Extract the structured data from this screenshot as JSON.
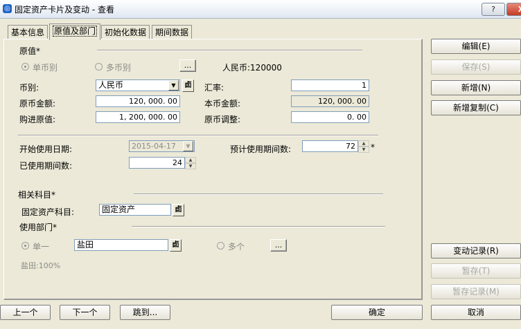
{
  "window": {
    "title": "固定资产卡片及变动 - 查看",
    "help_label": "?",
    "close_label": "X"
  },
  "tabs": [
    "基本信息",
    "原值及部门",
    "初始化数据",
    "期间数据"
  ],
  "original_value": {
    "section_title": "原值*",
    "radio_single": "单币别",
    "radio_multi": "多币别",
    "browse_label": "...",
    "currency_info": "人民币:120000",
    "currency_label": "币别:",
    "currency_value": "人民币",
    "rate_label": "汇率:",
    "rate_value": "1",
    "orig_amount_label": "原币金额:",
    "orig_amount_value": "120, 000. 00",
    "local_amount_label": "本币金额:",
    "local_amount_value": "120, 000. 00",
    "purchase_value_label": "购进原值:",
    "purchase_value_value": "1, 200, 000. 00",
    "orig_adjust_label": "原币调整:",
    "orig_adjust_value": "0. 00"
  },
  "usage": {
    "start_date_label": "开始使用日期:",
    "start_date_value": "2015-04-17",
    "expected_periods_label": "预计使用期间数:",
    "expected_periods_value": "72",
    "required_mark": "*",
    "used_periods_label": "已使用期间数:",
    "used_periods_value": "24"
  },
  "accounts": {
    "section_title": "相关科目*",
    "asset_account_label": "固定资产科目:",
    "asset_account_value": "固定资产"
  },
  "department": {
    "section_title": "使用部门*",
    "radio_single": "单一",
    "dept_value": "盐田",
    "radio_multi": "多个",
    "browse_label": "...",
    "allocation_text": "盐田:100%"
  },
  "ref_icon_label": "卣",
  "right_buttons": {
    "edit": "编辑(E)",
    "save": "保存(S)",
    "new": "新增(N)",
    "new_copy": "新增复制(C)",
    "change_record": "变动记录(R)",
    "temp_save": "暂存(T)",
    "temp_record": "暂存记录(M)"
  },
  "bottom_buttons": {
    "prev": "上一个",
    "next": "下一个",
    "jump": "跳到...",
    "ok": "确定",
    "cancel": "取消"
  }
}
